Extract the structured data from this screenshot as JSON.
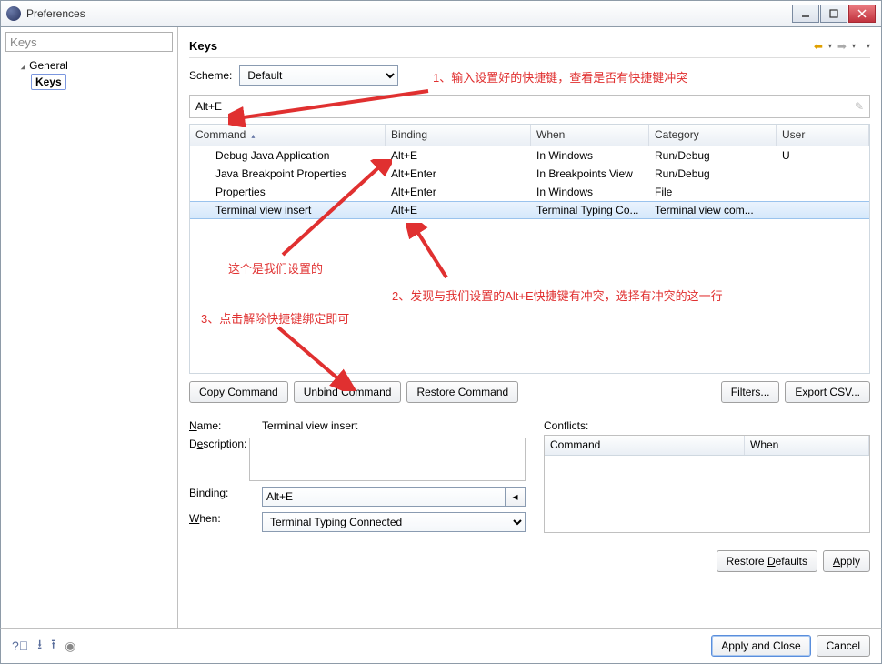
{
  "window": {
    "title": "Preferences"
  },
  "sidebar": {
    "search_placeholder": "Keys",
    "tree": {
      "root": "General",
      "selected": "Keys"
    }
  },
  "panel": {
    "title": "Keys",
    "scheme_label": "Scheme:",
    "scheme_value": "Default",
    "filter_value": "Alt+E"
  },
  "columns": {
    "command": "Command",
    "binding": "Binding",
    "when": "When",
    "category": "Category",
    "user": "User"
  },
  "rows": [
    {
      "command": "Debug Java Application",
      "binding": "Alt+E",
      "when": "In Windows",
      "category": "Run/Debug",
      "user": "U"
    },
    {
      "command": "Java Breakpoint Properties",
      "binding": "Alt+Enter",
      "when": "In Breakpoints View",
      "category": "Run/Debug",
      "user": ""
    },
    {
      "command": "Properties",
      "binding": "Alt+Enter",
      "when": "In Windows",
      "category": "File",
      "user": ""
    },
    {
      "command": "Terminal view insert",
      "binding": "Alt+E",
      "when": "Terminal Typing Co...",
      "category": "Terminal view com...",
      "user": ""
    }
  ],
  "buttons": {
    "copy": "Copy Command",
    "unbind": "Unbind Command",
    "restore": "Restore Command",
    "filters": "Filters...",
    "export": "Export CSV...",
    "restore_defaults": "Restore Defaults",
    "apply": "Apply",
    "apply_close": "Apply and Close",
    "cancel": "Cancel"
  },
  "detail": {
    "name_label": "Name:",
    "name_value": "Terminal view insert",
    "desc_label": "Description:",
    "binding_label": "Binding:",
    "binding_value": "Alt+E",
    "when_label": "When:",
    "when_value": "Terminal Typing Connected",
    "conflicts_label": "Conflicts:",
    "conflicts_cols": {
      "command": "Command",
      "when": "When"
    }
  },
  "annotations": {
    "a1": "1、输入设置好的快捷键，查看是否有快捷键冲突",
    "a2": "这个是我们设置的",
    "a3": "2、发现与我们设置的Alt+E快捷键有冲突，选择有冲突的这一行",
    "a4": "3、点击解除快捷键绑定即可"
  }
}
